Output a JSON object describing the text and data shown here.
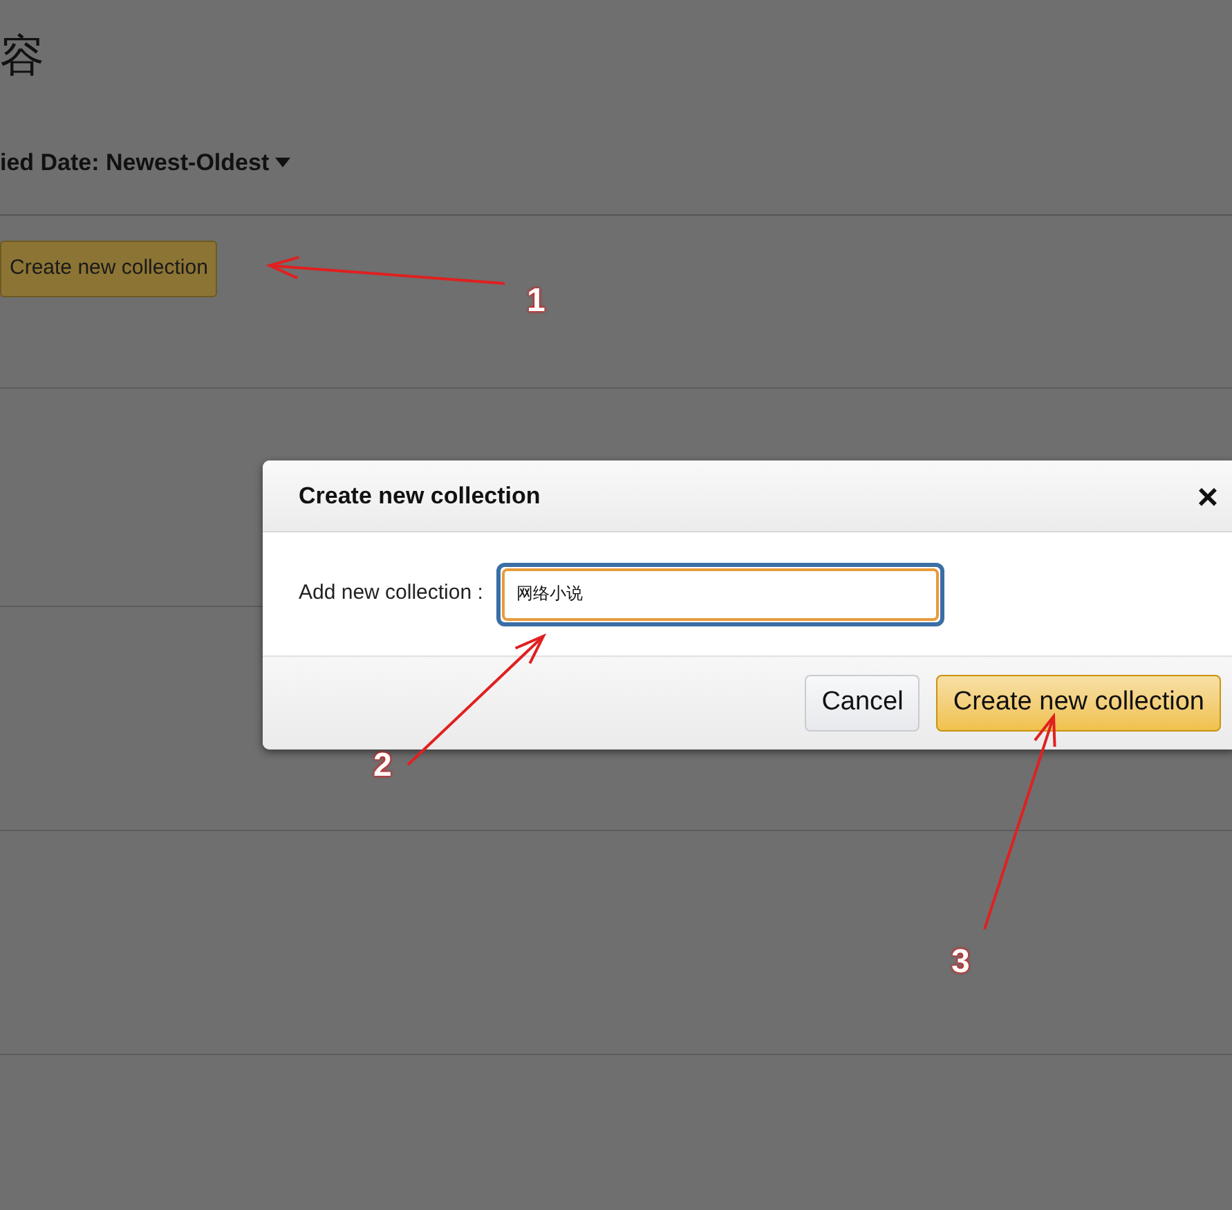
{
  "page": {
    "heading": "容",
    "sort": "ied Date: Newest-Oldest",
    "create_button": "Create new collection"
  },
  "dialog": {
    "title": "Create new collection",
    "close": "×",
    "field_label": "Add new collection :",
    "field_value": "网络小说",
    "buttons": [
      {
        "label": "Cancel",
        "kind": "secondary"
      },
      {
        "label": "Create new collection",
        "kind": "primary"
      }
    ]
  },
  "annotations": [
    {
      "label": "1"
    },
    {
      "label": "2"
    },
    {
      "label": "3"
    }
  ]
}
